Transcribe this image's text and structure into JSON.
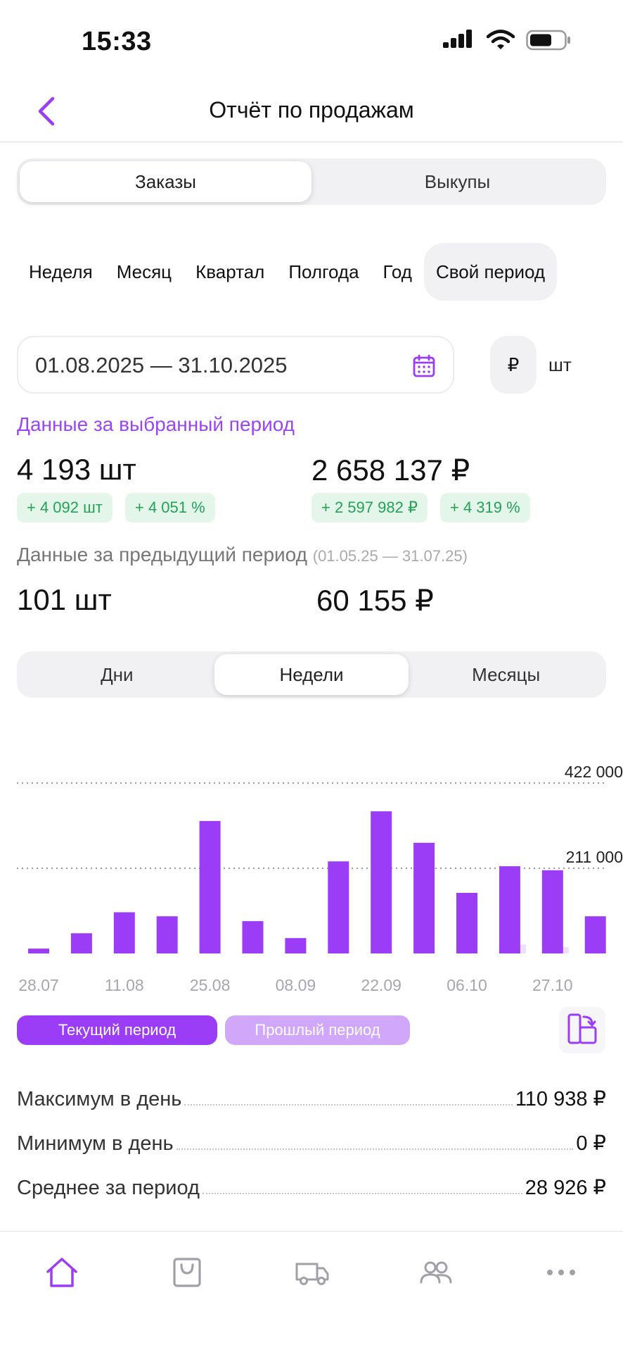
{
  "status_bar": {
    "time": "15:33"
  },
  "header": {
    "title": "Отчёт по продажам",
    "back_icon": "chevron-left-icon"
  },
  "type_tabs": [
    {
      "label": "Заказы",
      "active": true
    },
    {
      "label": "Выкупы",
      "active": false
    }
  ],
  "period_tabs": [
    {
      "label": "Неделя",
      "active": false
    },
    {
      "label": "Месяц",
      "active": false
    },
    {
      "label": "Квартал",
      "active": false
    },
    {
      "label": "Полгода",
      "active": false
    },
    {
      "label": "Год",
      "active": false
    },
    {
      "label": "Свой период",
      "active": true
    }
  ],
  "date_range": {
    "value": "01.08.2025 — 31.10.2025",
    "icon": "calendar-icon"
  },
  "units": {
    "rub": "₽",
    "sht": "шт",
    "selected": "rub"
  },
  "current": {
    "label": "Данные за выбранный период",
    "quantity": "4 193 шт",
    "revenue": "2 658 137 ₽",
    "chips": [
      "+ 4 092 шт",
      "+ 4 051 %",
      "+ 2 597 982 ₽",
      "+ 4 319 %"
    ]
  },
  "previous": {
    "label": "Данные за предыдущий период",
    "dates": "(01.05.25 — 31.07.25)",
    "quantity": "101 шт",
    "revenue": "60 155 ₽"
  },
  "granularity_tabs": [
    {
      "label": "Дни",
      "active": false
    },
    {
      "label": "Недели",
      "active": true
    },
    {
      "label": "Месяцы",
      "active": false
    }
  ],
  "chart_data": {
    "type": "bar",
    "x_ticks": [
      "28.07",
      "11.08",
      "25.08",
      "08.09",
      "22.09",
      "06.10",
      "27.10"
    ],
    "y_ticks": [
      {
        "value": 422000,
        "label": "422 000"
      },
      {
        "value": 211000,
        "label": "211 000"
      }
    ],
    "ylim": [
      0,
      422000
    ],
    "grid": "dotted",
    "colors": {
      "current": "#9b3cf7",
      "previous": "#ece0fc"
    },
    "series": [
      {
        "values": [
          12000,
          50000,
          102000,
          92000,
          328000,
          80000,
          38000,
          228000,
          352000,
          274000,
          150000,
          216000,
          206000,
          92000
        ]
      },
      {
        "values": [
          0,
          0,
          0,
          0,
          0,
          0,
          0,
          0,
          0,
          0,
          0,
          22000,
          16000,
          0
        ]
      }
    ]
  },
  "legend": {
    "current": "Текущий период",
    "previous": "Прошлый период",
    "rotate_icon": "rotate-screen-icon"
  },
  "stats": [
    {
      "label": "Максимум в день",
      "value": "110 938 ₽"
    },
    {
      "label": "Минимум в день",
      "value": "0 ₽"
    },
    {
      "label": "Среднее за период",
      "value": "28 926 ₽"
    }
  ],
  "tab_bar": {
    "items": [
      "home-icon",
      "shopping-bag-icon",
      "truck-icon",
      "users-icon",
      "more-icon"
    ],
    "active": "home-icon"
  },
  "colors": {
    "accent": "#9b3cf7",
    "positive_bg": "#e3f6e9",
    "positive_text": "#25a258"
  }
}
